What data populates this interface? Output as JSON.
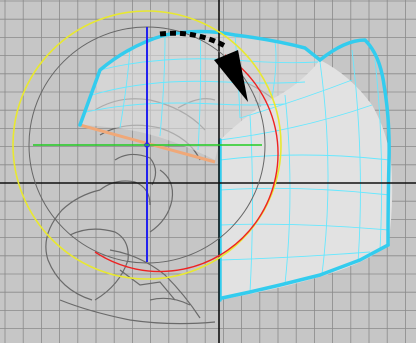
{
  "viewport": {
    "background_color": "#c6c6c6",
    "grid_color": "#8a8a8a",
    "world_axis_color": "#111111",
    "mesh_color": "#66e8ff",
    "selection_edge_color": "#33ccee",
    "sketch_color": "#6a6a6a",
    "helmet_fill_color": "#e2e2e2",
    "selected_edge_color": "#f0a878"
  },
  "rotate_gizmo": {
    "view_ring_color": "#e8e830",
    "arcball_ring_color": "#666666",
    "x_axis_color": "#22cc22",
    "y_axis_color": "#2222ee",
    "z_axis_color": "#ee2222"
  },
  "rotation_arrow": {
    "icon": "curved-rotation-arrow-icon",
    "color": "#000000"
  }
}
